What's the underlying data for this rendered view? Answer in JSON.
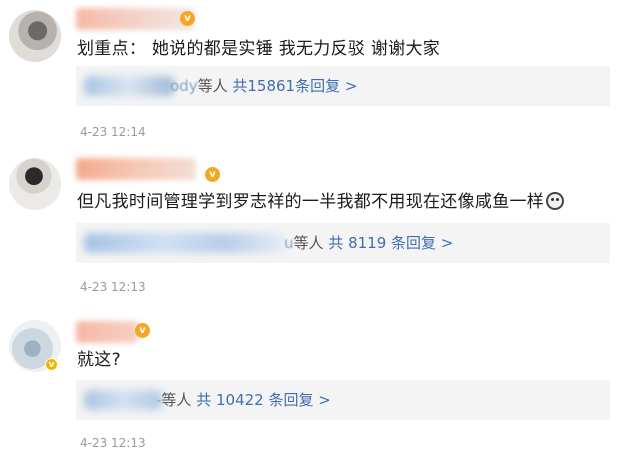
{
  "comments": [
    {
      "text": "划重点： 她说的都是实锤 我无力反驳 谢谢大家",
      "reply_name_suffix": "ody",
      "reply_label": "等人",
      "reply_count": "共15861条回复 >",
      "time": "4-23 12:14"
    },
    {
      "text": "但凡我时间管理学到罗志祥的一半我都不用现在还像咸鱼一样",
      "reply_name_suffix": "u",
      "reply_label": "等人",
      "reply_count": "共 8119 条回复 >",
      "time": "4-23 12:13"
    },
    {
      "text": "就这?",
      "reply_name_suffix": "-",
      "reply_label": "等人",
      "reply_count": "共 10422 条回复 >",
      "time": "4-23 12:13"
    }
  ],
  "badge_glyph": "v",
  "verified_glyph": "v",
  "colors": {
    "reply_count": "#3f6db3",
    "reply_bg": "#f4f4f4",
    "timestamp": "#9a9a9a",
    "badge": "#f5a623"
  }
}
